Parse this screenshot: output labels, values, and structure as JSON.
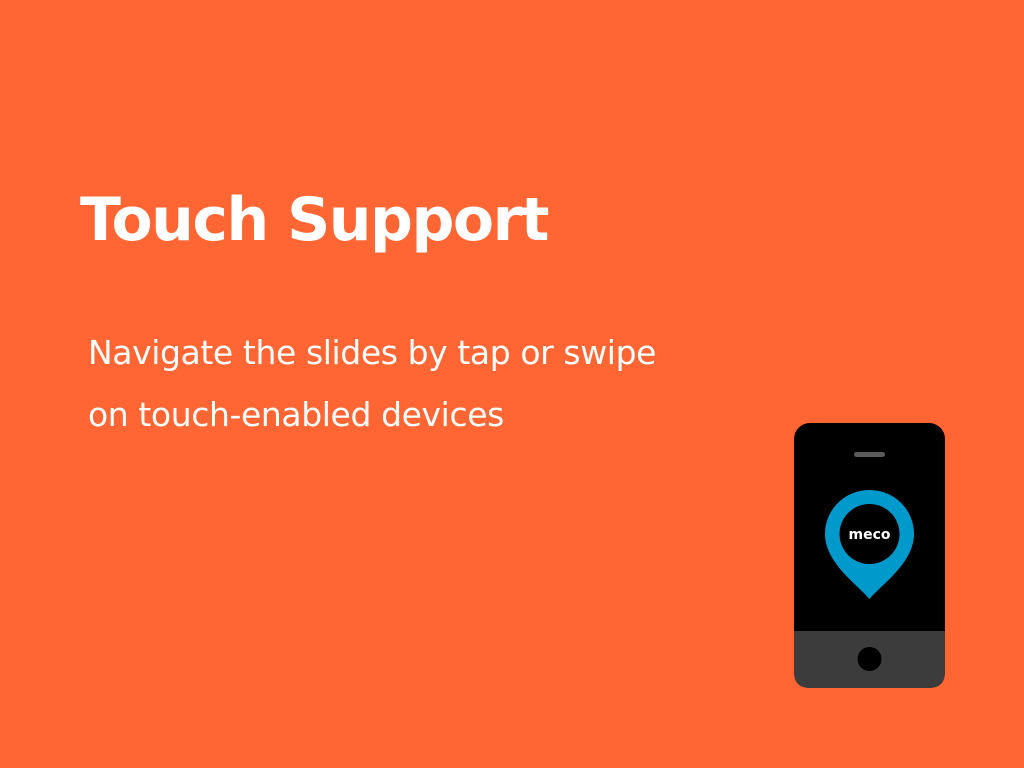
{
  "slide": {
    "title": "Touch Support",
    "subtitle_lines": [
      "Navigate the slides by tap or swipe",
      "on touch-enabled devices"
    ]
  },
  "phone": {
    "logo_text": "meco",
    "icon": "location-pin-icon"
  },
  "colors": {
    "background": "#FF6633",
    "text": "#FFFFFF",
    "phone_body": "#000000",
    "phone_bottom": "#3C3C3C",
    "pin": "#0099CC"
  }
}
